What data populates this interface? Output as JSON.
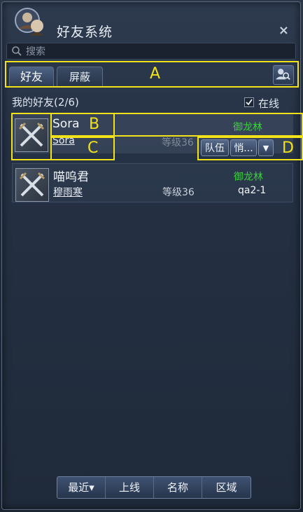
{
  "window": {
    "title": "好友系统",
    "close_label": "×"
  },
  "search": {
    "placeholder": "搜索"
  },
  "tabs": [
    {
      "label": "好友",
      "active": true
    },
    {
      "label": "屏蔽",
      "active": false
    }
  ],
  "friends_header": {
    "label": "我的好友(2/6)",
    "online_label": "在线",
    "online_checked": true
  },
  "friends": [
    {
      "name": "Sora",
      "subname": "Sora",
      "level": "等级36",
      "zone": "御龙林",
      "server": ""
    },
    {
      "name": "喵呜君",
      "subname": "穆雨寒",
      "level": "等级36",
      "zone": "御龙林",
      "server": "qa2-1"
    }
  ],
  "row_actions": {
    "team_label": "队伍",
    "whisper_label": "悄...",
    "more_label": "▼"
  },
  "annotations": {
    "A": "A",
    "B": "B",
    "C": "C",
    "D": "D"
  },
  "sort_buttons": [
    {
      "label": "最近▾"
    },
    {
      "label": "上线"
    },
    {
      "label": "名称"
    },
    {
      "label": "区域"
    }
  ],
  "colors": {
    "annotation": "#f2e21a",
    "zone_text": "#3bd13b"
  },
  "icons": {
    "avatar": "character-portrait-icon",
    "search": "magnifier-icon",
    "friend_avatar": "crossed-swords-icon",
    "find_friend": "person-search-icon"
  }
}
